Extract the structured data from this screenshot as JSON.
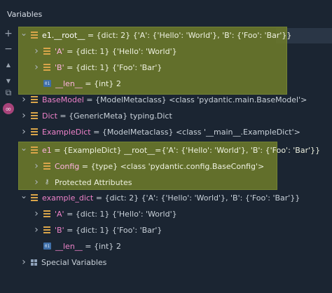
{
  "header": {
    "title": "Variables"
  },
  "toolbar": [
    {
      "name": "add-watch-icon",
      "glyph": "+"
    },
    {
      "name": "remove-watch-icon",
      "glyph": "−"
    },
    {
      "name": "move-up-icon",
      "glyph": "▲"
    },
    {
      "name": "move-down-icon",
      "glyph": "▼"
    },
    {
      "name": "copy-icon",
      "glyph": "⧉"
    },
    {
      "name": "view-glasses-icon",
      "glyph": "∞"
    }
  ],
  "colors": {
    "background": "#1b2532",
    "highlight": "#6c7a2b",
    "var_name": "#ee82c9",
    "field_icon": "#d9a54a",
    "int_icon": "#3f6fa8",
    "glasses_icon": "#a8437a"
  },
  "rows": [
    {
      "indent": 0,
      "expanded": true,
      "icon": "field",
      "name": "e1.__root__",
      "root": true,
      "sep": " = ",
      "value": "{dict: 2} {'A': {'Hello': 'World'}, 'B': {'Foo': 'Bar'}}"
    },
    {
      "indent": 1,
      "expanded": false,
      "icon": "field",
      "name": "'A'",
      "sep": " = ",
      "value": "{dict: 1} {'Hello': 'World'}"
    },
    {
      "indent": 1,
      "expanded": false,
      "icon": "field",
      "name": "'B'",
      "sep": " = ",
      "value": "{dict: 1} {'Foo': 'Bar'}"
    },
    {
      "indent": 1,
      "leaf": true,
      "icon": "int",
      "name": "__len__",
      "sep": " = ",
      "value": "{int} 2"
    },
    {
      "indent": 0,
      "expanded": false,
      "icon": "field",
      "name": "BaseModel",
      "sep": " = ",
      "value": "{ModelMetaclass} <class 'pydantic.main.BaseModel'>"
    },
    {
      "indent": 0,
      "expanded": false,
      "icon": "field",
      "name": "Dict",
      "sep": " = ",
      "value": "{GenericMeta} typing.Dict"
    },
    {
      "indent": 0,
      "expanded": false,
      "icon": "field",
      "name": "ExampleDict",
      "sep": " = ",
      "value": "{ModelMetaclass} <class '__main__.ExampleDict'>"
    },
    {
      "indent": 0,
      "expanded": true,
      "icon": "field",
      "name": "e1",
      "sep": " = ",
      "value": "{ExampleDict} __root__={'A': {'Hello': 'World'}, 'B': {'Foo': 'Bar'}}"
    },
    {
      "indent": 1,
      "expanded": false,
      "icon": "field",
      "name": "Config",
      "sep": " = ",
      "value": "{type} <class 'pydantic.config.BaseConfig'>"
    },
    {
      "indent": 1,
      "expanded": false,
      "icon": "protected",
      "plain": "Protected Attributes"
    },
    {
      "indent": 0,
      "expanded": true,
      "icon": "field",
      "name": "example_dict",
      "sep": " = ",
      "value": "{dict: 2} {'A': {'Hello': 'World'}, 'B': {'Foo': 'Bar'}}"
    },
    {
      "indent": 1,
      "expanded": false,
      "icon": "field",
      "name": "'A'",
      "sep": " = ",
      "value": "{dict: 1} {'Hello': 'World'}"
    },
    {
      "indent": 1,
      "expanded": false,
      "icon": "field",
      "name": "'B'",
      "sep": " = ",
      "value": "{dict: 1} {'Foo': 'Bar'}"
    },
    {
      "indent": 1,
      "leaf": true,
      "icon": "int",
      "name": "__len__",
      "sep": " = ",
      "value": "{int} 2"
    },
    {
      "indent": 0,
      "expanded": false,
      "icon": "special",
      "plain": "Special Variables"
    }
  ],
  "int_icon_label": "01"
}
